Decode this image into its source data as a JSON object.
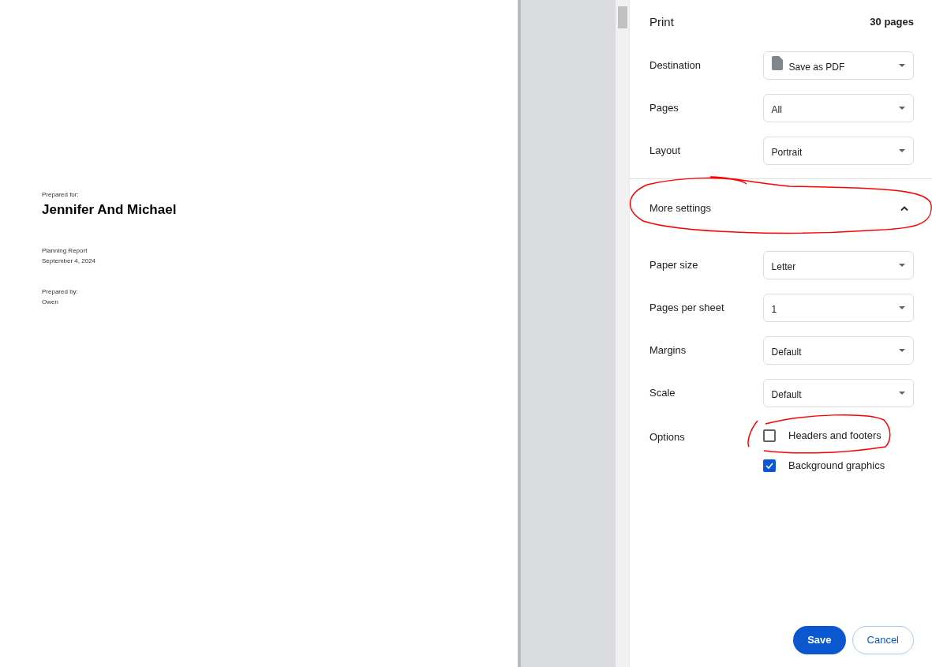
{
  "preview": {
    "blocks": [
      {
        "lines": [
          {
            "text": "Prepared for:",
            "kind": "small"
          },
          {
            "text": "Jennifer And Michael",
            "kind": "title"
          }
        ]
      },
      {
        "lines": [
          {
            "text": "Planning Report",
            "kind": "small"
          },
          {
            "text": "September 4, 2024",
            "kind": "small"
          }
        ]
      },
      {
        "lines": [
          {
            "text": "Prepared by:",
            "kind": "small"
          },
          {
            "text": "Owen",
            "kind": "small"
          }
        ]
      }
    ]
  },
  "print_panel": {
    "title": "Print",
    "page_count": "30 pages",
    "settings": [
      {
        "label": "Destination",
        "value": "Save as PDF",
        "kind": "destination"
      },
      {
        "label": "Pages",
        "value": "All",
        "kind": "select"
      },
      {
        "label": "Layout",
        "value": "Portrait",
        "kind": "select"
      }
    ],
    "more_settings": {
      "label": "More settings",
      "expanded": true
    },
    "more": [
      {
        "label": "Paper size",
        "value": "Letter",
        "kind": "select"
      },
      {
        "label": "Pages per sheet",
        "value": "1",
        "kind": "select"
      },
      {
        "label": "Margins",
        "value": "Default",
        "kind": "select"
      },
      {
        "label": "Scale",
        "value": "Default",
        "kind": "select"
      }
    ],
    "options": {
      "label": "Options",
      "items": [
        {
          "label": "Headers and footers",
          "checked": false
        },
        {
          "label": "Background graphics",
          "checked": true
        }
      ]
    },
    "buttons": [
      {
        "label": "Save",
        "kind": "primary"
      },
      {
        "label": "Cancel",
        "kind": "secondary"
      }
    ]
  }
}
